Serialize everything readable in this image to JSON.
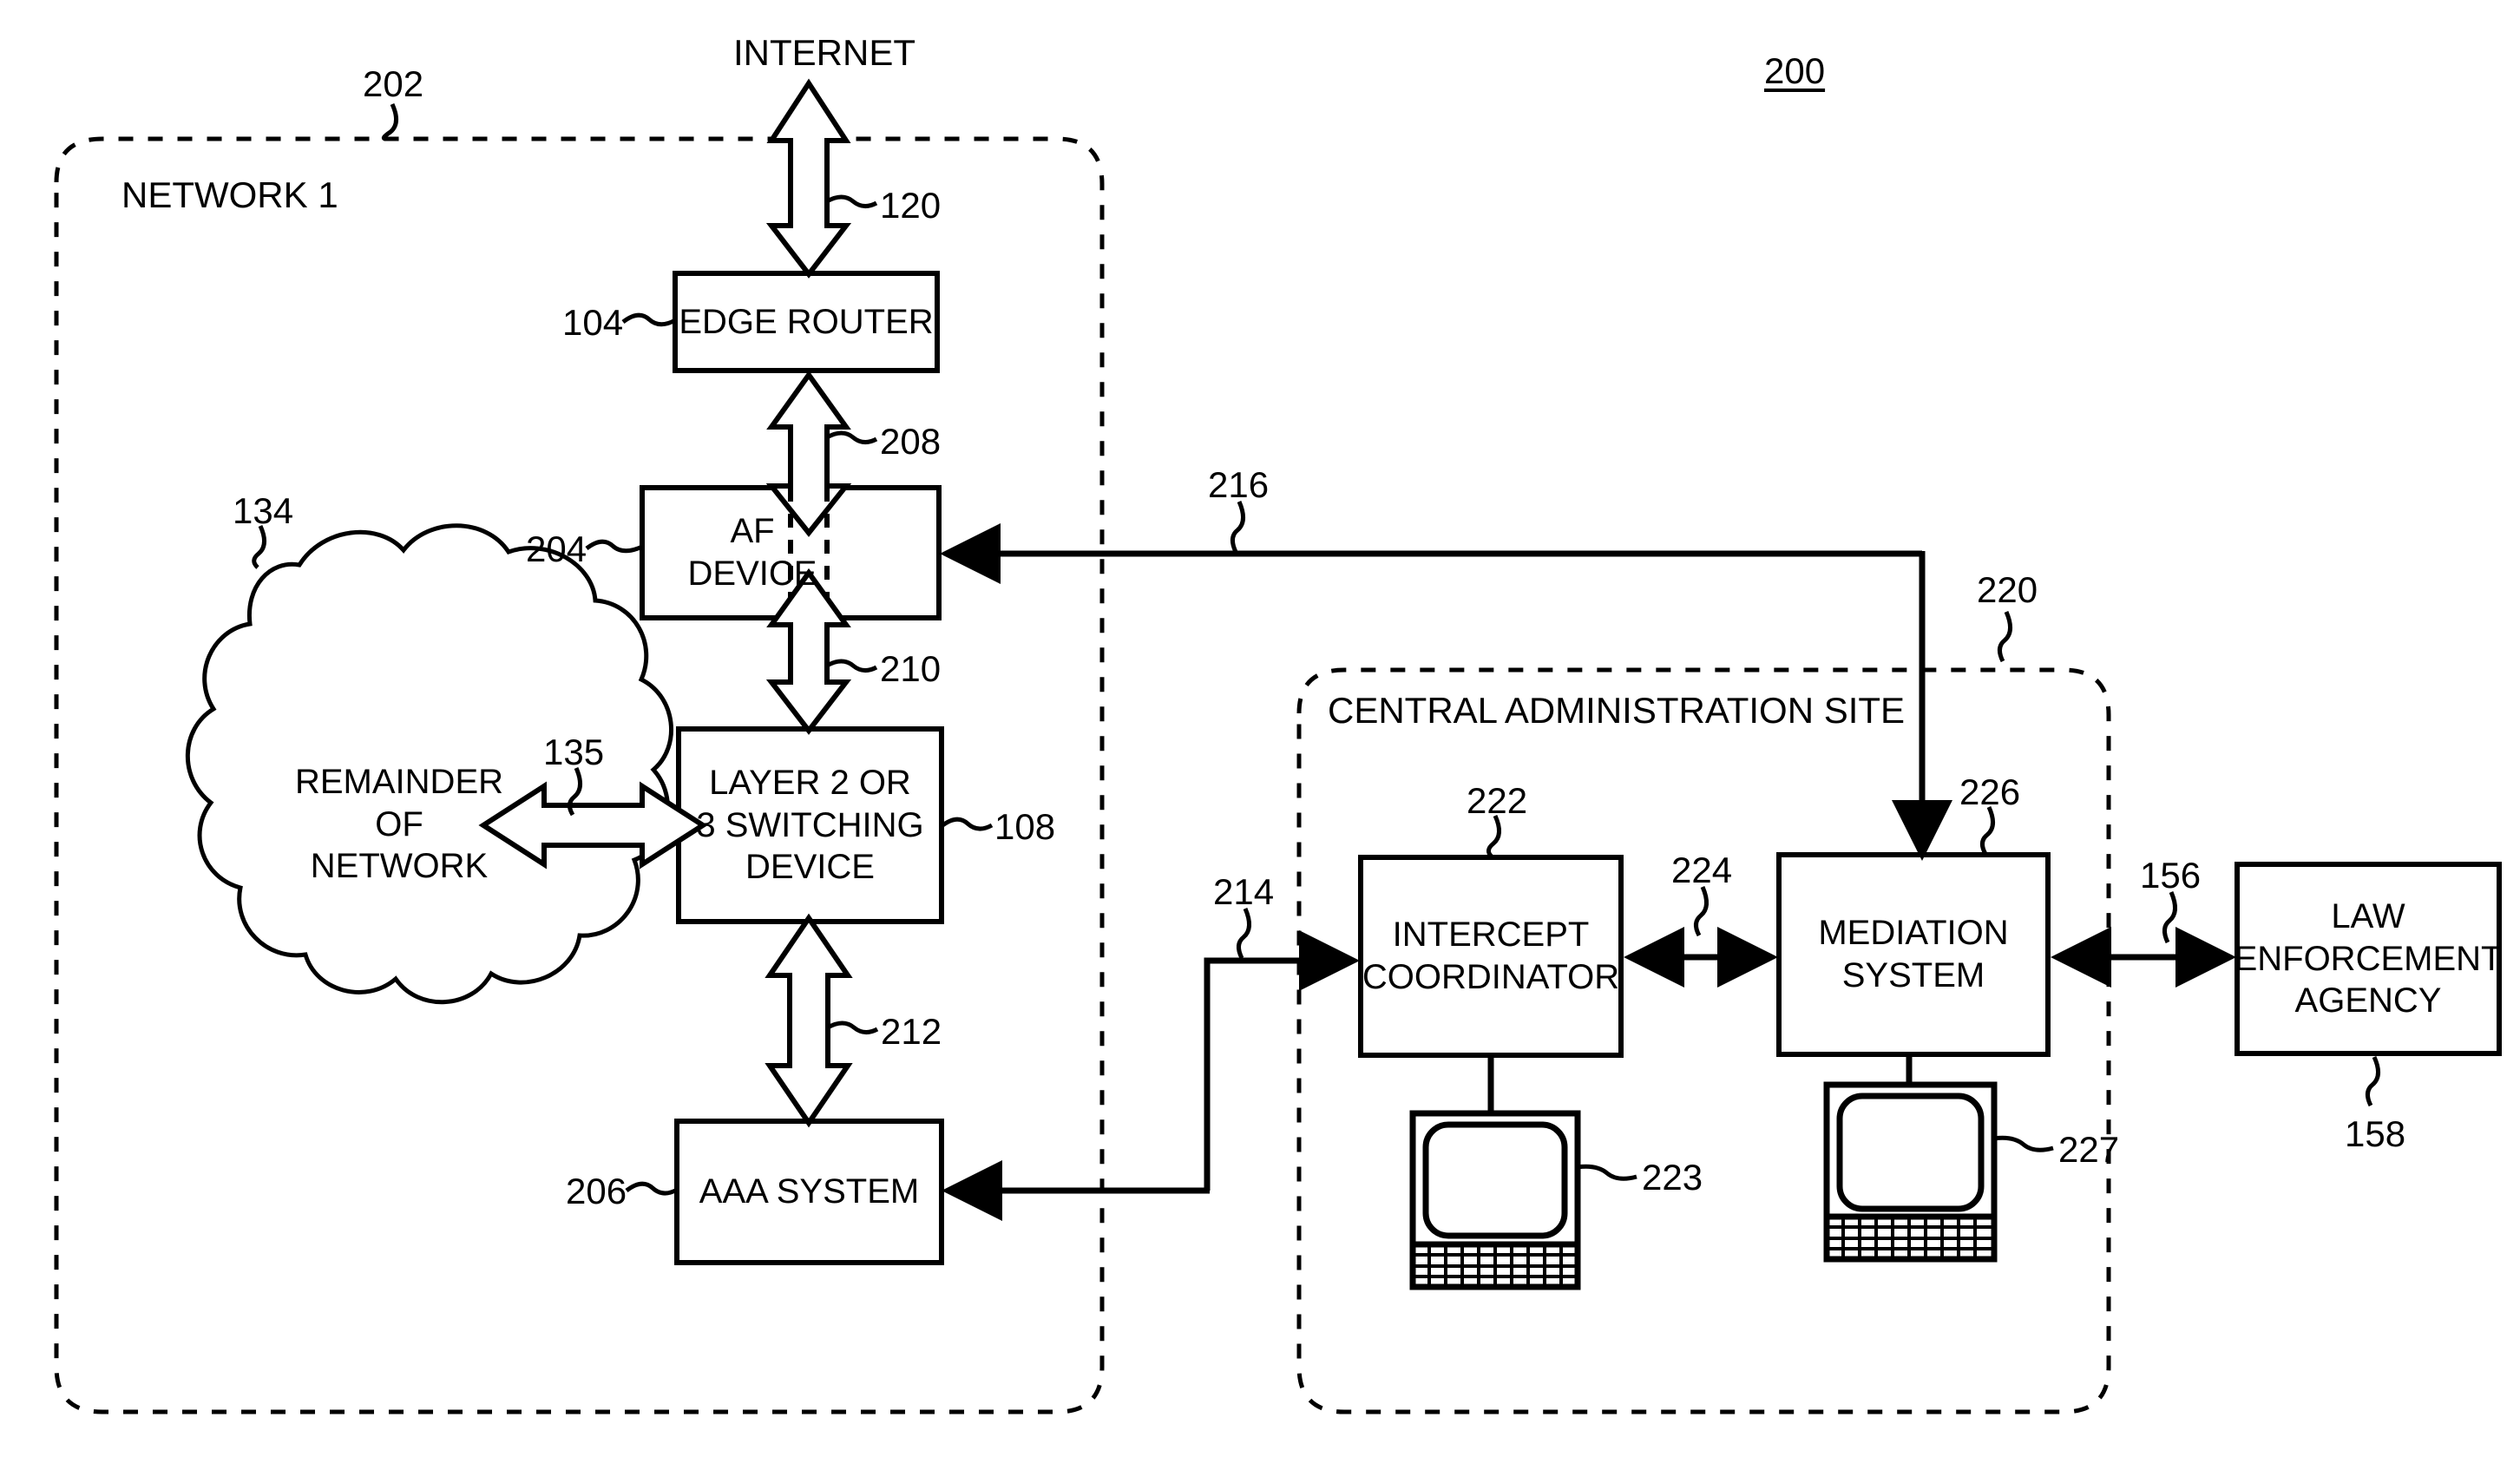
{
  "figure": {
    "figure_ref": "200",
    "internet_label": "INTERNET"
  },
  "regions": [
    {
      "id": "network1",
      "label": "NETWORK 1",
      "ref": "202"
    },
    {
      "id": "central_admin",
      "label": "CENTRAL ADMINISTRATION SITE",
      "ref": "220"
    }
  ],
  "nodes": [
    {
      "id": "edge_router",
      "label": "EDGE ROUTER",
      "ref": "104"
    },
    {
      "id": "af_device",
      "label": "AF\nDEVICE",
      "ref": "204"
    },
    {
      "id": "switching_device",
      "label": "LAYER 2 OR\n3 SWITCHING\nDEVICE",
      "ref": "108"
    },
    {
      "id": "aaa_system",
      "label": "AAA SYSTEM",
      "ref": "206"
    },
    {
      "id": "remainder_cloud",
      "label": "REMAINDER\nOF\nNETWORK",
      "ref": "134"
    },
    {
      "id": "intercept_coordinator",
      "label": "INTERCEPT\nCOORDINATOR",
      "ref": "222"
    },
    {
      "id": "mediation_system",
      "label": "MEDIATION\nSYSTEM",
      "ref": "226"
    },
    {
      "id": "law_enforcement",
      "label": "LAW\nENFORCEMENT\nAGENCY",
      "ref": "158"
    }
  ],
  "terminals": [
    {
      "id": "terminal_ic",
      "ref": "223",
      "attached_to": "intercept_coordinator"
    },
    {
      "id": "terminal_ms",
      "ref": "227",
      "attached_to": "mediation_system"
    }
  ],
  "connections": [
    {
      "id": "internet_link",
      "ref": "120",
      "from": "INTERNET",
      "to": "edge_router",
      "style": "hollow-double-arrow"
    },
    {
      "id": "er_af_link",
      "ref": "208",
      "from": "af_device",
      "to": "edge_router",
      "style": "hollow-double-arrow"
    },
    {
      "id": "af_sw_link",
      "ref": "210",
      "from": "switching_device",
      "to": "af_device",
      "style": "hollow-double-arrow"
    },
    {
      "id": "sw_aaa_link",
      "ref": "212",
      "from": "switching_device",
      "to": "aaa_system",
      "style": "hollow-double-arrow"
    },
    {
      "id": "cloud_sw_link",
      "ref": "135",
      "from": "remainder_cloud",
      "to": "switching_device",
      "style": "hollow-double-arrow"
    },
    {
      "id": "ms_af_link",
      "ref": "216",
      "from": "mediation_system",
      "to": "af_device",
      "style": "solid-arrow"
    },
    {
      "id": "ic_aaa_link",
      "ref": "214",
      "from": "intercept_coordinator",
      "to": "aaa_system",
      "style": "solid-arrow"
    },
    {
      "id": "ic_ms_link",
      "ref": "224",
      "from": "intercept_coordinator",
      "to": "mediation_system",
      "style": "solid-double-arrow"
    },
    {
      "id": "ms_lea_link",
      "ref": "156",
      "from": "mediation_system",
      "to": "law_enforcement",
      "style": "solid-double-arrow"
    }
  ],
  "colors": {
    "stroke": "#000000",
    "background": "#ffffff"
  }
}
